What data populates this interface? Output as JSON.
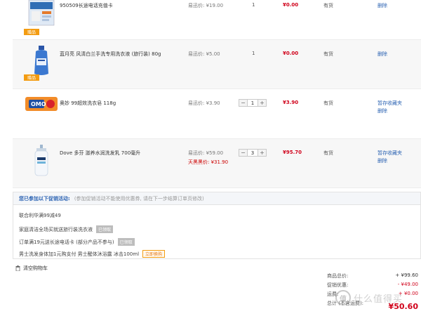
{
  "items": [
    {
      "name": "950509长途电话充值卡",
      "price_label": "易迅价: ¥19.00",
      "member_price": "",
      "qty": "1",
      "has_stepper": false,
      "subtotal": "¥0.00",
      "stock": "有货",
      "actions": [
        "删除"
      ],
      "badge": "赠品",
      "icon": "phone-card-icon"
    },
    {
      "name": "蓝月亮 风清白兰手洗专用洗衣液 (旅行装) 80g",
      "price_label": "易迅价: ¥5.00",
      "member_price": "",
      "qty": "1",
      "has_stepper": false,
      "subtotal": "¥0.00",
      "stock": "有货",
      "actions": [
        "删除"
      ],
      "badge": "赠品",
      "icon": "detergent-bottle-icon"
    },
    {
      "name": "奥妙 99超效洗衣皂 118g",
      "price_label": "易迅价: ¥3.90",
      "member_price": "",
      "qty": "1",
      "has_stepper": true,
      "subtotal": "¥3.90",
      "stock": "有货",
      "actions": [
        "暂存收藏夹",
        "删除"
      ],
      "badge": "",
      "icon": "soap-bar-icon"
    },
    {
      "name": "Dove 多芬 滋养水润洗发乳 700毫升",
      "price_label": "易迅价: ¥59.00",
      "member_price": "天黑黑价: ¥31.90",
      "qty": "3",
      "has_stepper": true,
      "subtotal": "¥95.70",
      "stock": "有货",
      "actions": [
        "暂存收藏夹",
        "删除"
      ],
      "badge": "",
      "icon": "shampoo-bottle-icon"
    }
  ],
  "promo": {
    "title": "您已参加以下促销活动:",
    "note": "(参加促销活动不能使用优惠券, 请在下一步结算订单页修改)",
    "lines": [
      {
        "text": "联合利华满99减49",
        "tag": "",
        "tag_style": ""
      },
      {
        "text": "家庭清洁全场买就送旅行装洗衣液",
        "tag": "已领取",
        "tag_style": "gray"
      },
      {
        "text": "订单满19元送长途电话卡 (部分产品不参与)",
        "tag": "已领取",
        "tag_style": "gray"
      },
      {
        "text": "男士洗发身体加1元购支付 男士醒体沐浴露 冰击100ml",
        "tag": "立即换购",
        "tag_style": "orange"
      }
    ]
  },
  "clear_cart": "清空购物车",
  "totals": [
    {
      "label": "商品总价:",
      "value": "+ ¥99.60",
      "red": false
    },
    {
      "label": "促销优惠:",
      "value": "- ¥49.00",
      "red": true
    },
    {
      "label": "运费:",
      "value": "+ ¥0.00",
      "red": true
    },
    {
      "label": "总计 (不含运费):",
      "value": "",
      "red": false
    }
  ],
  "grand_total": "¥50.60",
  "watermark": {
    "glyph": "值",
    "text": "什么值得买"
  }
}
